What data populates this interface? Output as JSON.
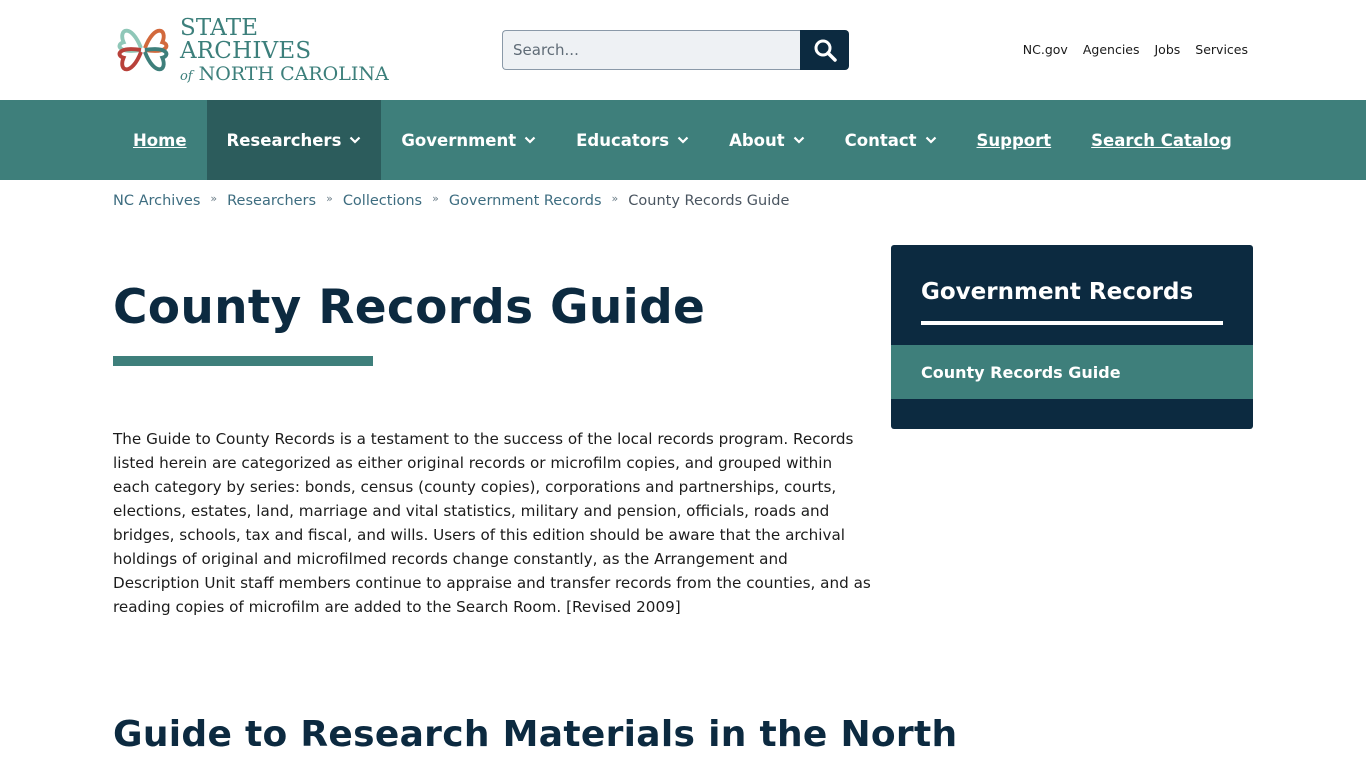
{
  "brand": {
    "line1": "STATE ARCHIVES",
    "line2_prefix": "of",
    "line2": "NORTH CAROLINA",
    "colors": {
      "teal": "#3e7f7b",
      "navy": "#0c2a40",
      "orange": "#d2693c",
      "red": "#b8413a"
    }
  },
  "search": {
    "placeholder": "Search...",
    "icon": "search-icon"
  },
  "util_links": [
    "NC.gov",
    "Agencies",
    "Jobs",
    "Services"
  ],
  "nav": {
    "items": [
      {
        "label": "Home",
        "dropdown": false,
        "style": "link"
      },
      {
        "label": "Researchers",
        "dropdown": true,
        "active": true
      },
      {
        "label": "Government",
        "dropdown": true
      },
      {
        "label": "Educators",
        "dropdown": true
      },
      {
        "label": "About",
        "dropdown": true
      },
      {
        "label": "Contact",
        "dropdown": true
      },
      {
        "label": "Support",
        "dropdown": false,
        "style": "link"
      },
      {
        "label": "Search Catalog",
        "dropdown": false,
        "style": "link"
      }
    ]
  },
  "breadcrumb": {
    "items": [
      "NC Archives",
      "Researchers",
      "Collections",
      "Government Records"
    ],
    "current": "County Records Guide",
    "separator": "»"
  },
  "main": {
    "title": "County Records Guide",
    "intro": "The Guide to County Records is a testament to the success of the local records program. Records listed herein are categorized as either original records or microfilm copies, and grouped within each category by series: bonds, census (county copies), corporations and partnerships, courts, elections, estates, land, marriage and vital statistics, military and pension, officials, roads and bridges, schools, tax and fiscal, and wills. Users of this edition should be aware that the archival holdings of original and microfilmed records change constantly, as the Arrangement and Description Unit staff members continue to appraise and transfer records from the counties, and as reading copies of microfilm are added to the Search Room. [Revised 2009]",
    "subheading": "Guide to Research Materials in the North"
  },
  "sidebar": {
    "title": "Government Records",
    "items": [
      {
        "label": "County Records Guide",
        "active": true
      }
    ]
  }
}
